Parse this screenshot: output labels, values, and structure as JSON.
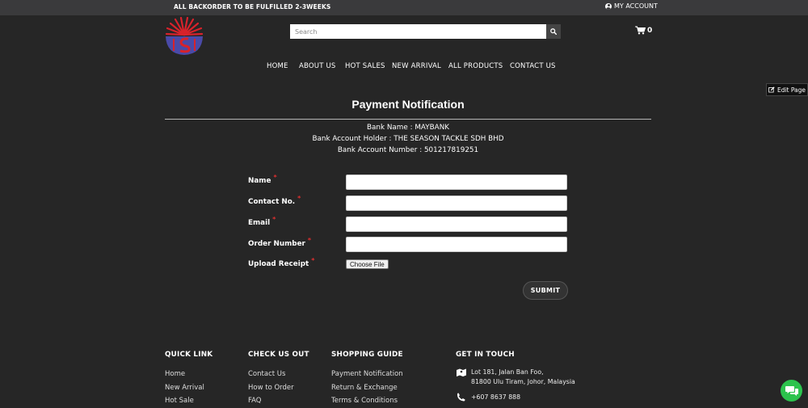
{
  "topbar": {
    "notice": "ALL BACKORDER TO BE FULFILLED 2-3WEEKS",
    "account_label": "MY ACCOUNT"
  },
  "header": {
    "search_placeholder": "Search",
    "cart_count": "0"
  },
  "nav": {
    "items": [
      "HOME",
      "ABOUT US",
      "HOT SALES",
      "NEW ARRIVAL",
      "ALL PRODUCTS",
      "CONTACT US"
    ]
  },
  "edit_page_label": "Edit Page",
  "main": {
    "title": "Payment Notification",
    "bank_name": "Bank Name : MAYBANK",
    "bank_holder": "Bank Account Holder : THE SEASON TACKLE SDH BHD",
    "bank_number": "Bank Account Number : 501217819251"
  },
  "form": {
    "name_label": "Name",
    "contact_label": "Contact No.",
    "email_label": "Email",
    "order_label": "Order Number",
    "upload_label": "Upload Receipt",
    "required_mark": "*",
    "choose_file": "Choose File",
    "submit": "SUBMIT"
  },
  "footer": {
    "quick_link": {
      "heading": "QUICK LINK",
      "links": [
        "Home",
        "New Arrival",
        "Hot Sale"
      ]
    },
    "check_us_out": {
      "heading": "CHECK US OUT",
      "links": [
        "Contact Us",
        "How to Order",
        "FAQ"
      ]
    },
    "shopping_guide": {
      "heading": "SHOPPING GUIDE",
      "links": [
        "Payment Notification",
        "Return & Exchange",
        "Terms & Conditions"
      ]
    },
    "get_in_touch": {
      "heading": "GET IN TOUCH",
      "address_line1": "Lot 181, Jalan Ban Foo,",
      "address_line2": "81800 Ulu Tiram, Johor, Malaysia",
      "phone": "+607 8637 888"
    }
  },
  "colors": {
    "background": "#262626",
    "topbar": "#3a3a3c",
    "required": "#e03030",
    "chat_button": "#2cc34d",
    "logo_red": "#d8222b",
    "logo_blue": "#4a4aa8"
  }
}
